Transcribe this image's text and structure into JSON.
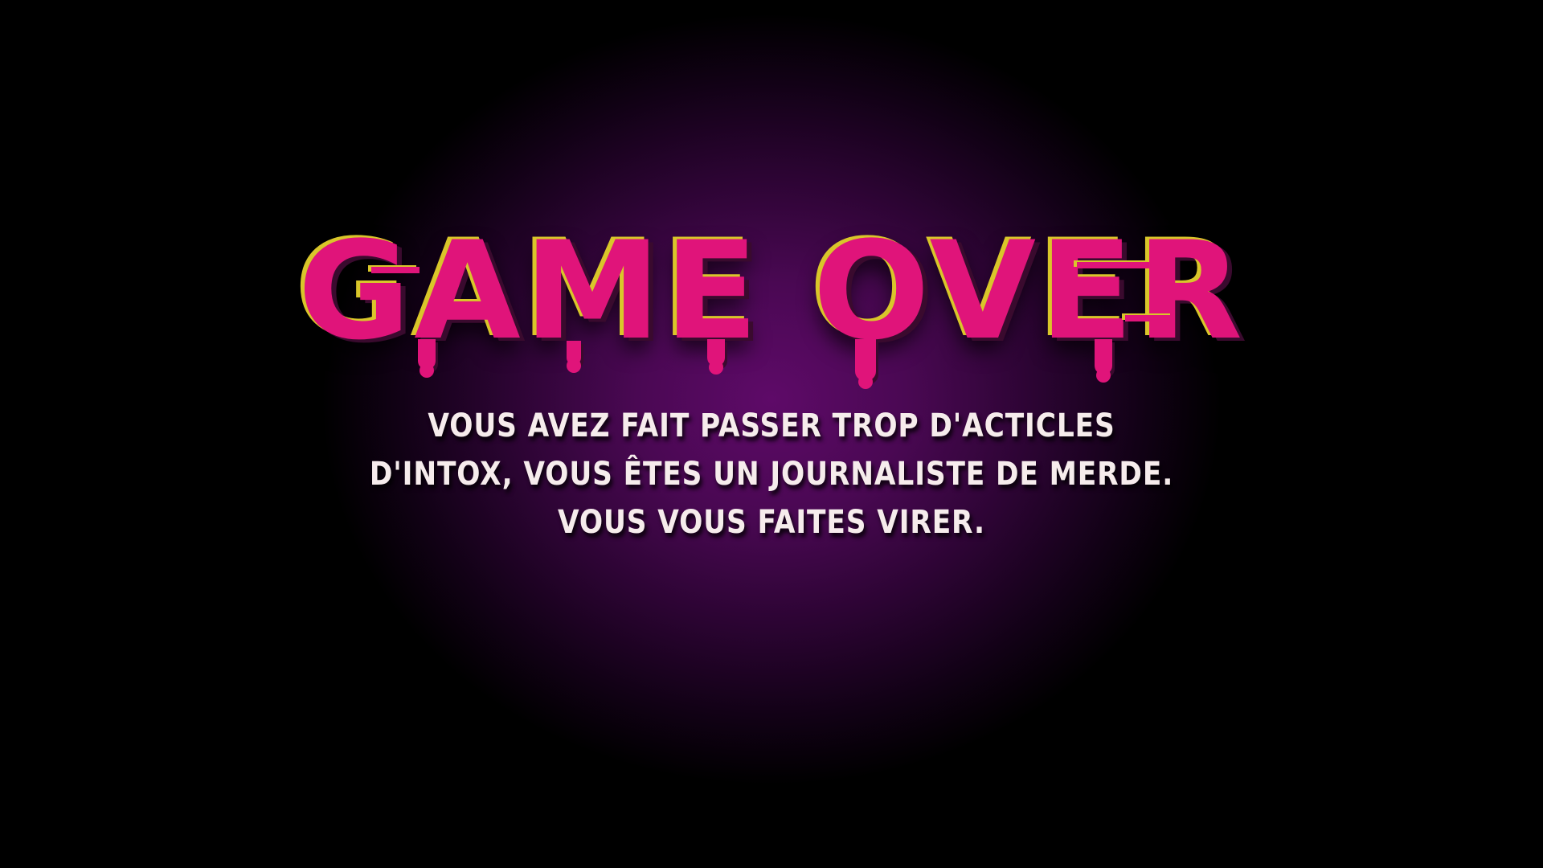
{
  "screen": {
    "title": "GAME OVER",
    "message_lines": [
      "VOUS AVEZ FAIT PASSER TROP D'ACTICLES",
      "D'INTOX, VOUS ÊTES UN JOURNALISTE DE MERDE.",
      "VOUS VOUS FAITES VIRER."
    ]
  },
  "colors": {
    "background_center": "#5e0a68",
    "background_edge": "#000000",
    "title": "#e0147a",
    "title_glitch": "#d9c62a",
    "message": "#f6ecec"
  }
}
